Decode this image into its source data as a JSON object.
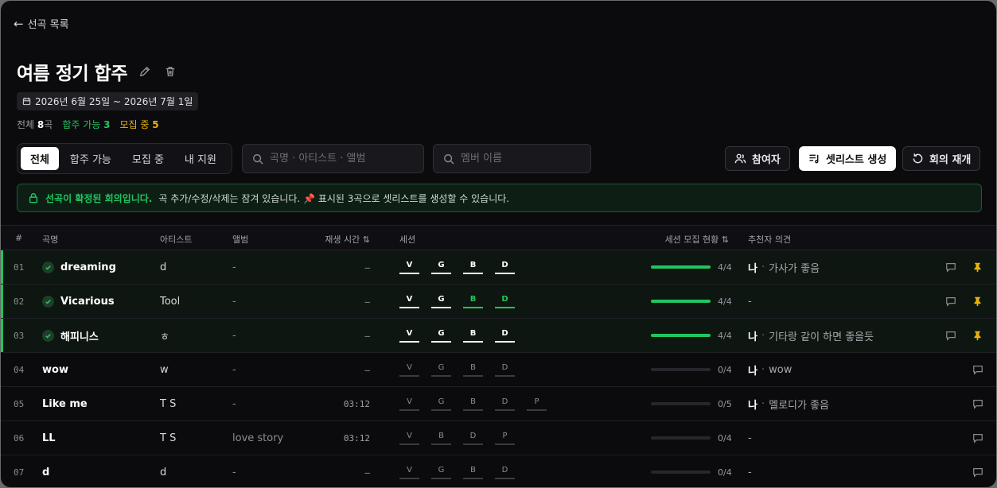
{
  "nav": {
    "back_label": "선곡 목록"
  },
  "header": {
    "title": "여름 정기 합주",
    "date_range": "2026년 6월 25일 ~ 2026년 7월 1일",
    "counts": {
      "all_label": "전체",
      "all_value": "8",
      "all_unit": "곡",
      "available_label": "합주 가능",
      "available_value": "3",
      "recruiting_label": "모집 중",
      "recruiting_value": "5"
    }
  },
  "toolbar": {
    "tabs": [
      "전체",
      "합주 가능",
      "모집 중",
      "내 지원"
    ],
    "active_tab": 0,
    "song_search_placeholder": "곡명 · 아티스트 · 앨범",
    "member_search_placeholder": "멤버 이름",
    "participants_label": "참여자",
    "setlist_label": "셋리스트 생성",
    "resume_label": "회의 재개"
  },
  "notice": {
    "strong": "선곡이 확정된 회의입니다.",
    "text": "곡 추가/수정/삭제는 잠겨 있습니다. 📌 표시된 3곡으로 셋리스트를 생성할 수 있습니다."
  },
  "table": {
    "columns": {
      "num": "#",
      "title": "곡명",
      "artist": "아티스트",
      "album": "앨범",
      "duration": "재생 시간 ⇅",
      "session": "세션",
      "progress": "세션 모집 현황 ⇅",
      "opinion": "추천자 의견"
    },
    "rows": [
      {
        "num": "01",
        "title": "dreaming",
        "artist": "d",
        "album": "-",
        "duration": "–",
        "confirmed": true,
        "sessions": [
          {
            "k": "V",
            "s": "filled"
          },
          {
            "k": "G",
            "s": "filled"
          },
          {
            "k": "B",
            "s": "filled"
          },
          {
            "k": "D",
            "s": "filled"
          }
        ],
        "progress": "4/4",
        "fill": 1.0,
        "who": "나",
        "opinion": "가사가 좋음",
        "pinned": true
      },
      {
        "num": "02",
        "title": "Vicarious",
        "artist": "Tool",
        "album": "-",
        "duration": "–",
        "confirmed": true,
        "sessions": [
          {
            "k": "V",
            "s": "filled"
          },
          {
            "k": "G",
            "s": "filled"
          },
          {
            "k": "B",
            "s": "done"
          },
          {
            "k": "D",
            "s": "done"
          }
        ],
        "progress": "4/4",
        "fill": 1.0,
        "who": "",
        "opinion": "-",
        "pinned": true
      },
      {
        "num": "03",
        "title": "해피니스",
        "artist": "ㅎ",
        "album": "-",
        "duration": "–",
        "confirmed": true,
        "sessions": [
          {
            "k": "V",
            "s": "filled"
          },
          {
            "k": "G",
            "s": "filled"
          },
          {
            "k": "B",
            "s": "filled"
          },
          {
            "k": "D",
            "s": "filled"
          }
        ],
        "progress": "4/4",
        "fill": 1.0,
        "who": "나",
        "opinion": "기타랑 같이 하면 좋을듯",
        "pinned": true
      },
      {
        "num": "04",
        "title": "wow",
        "artist": "w",
        "album": "-",
        "duration": "–",
        "confirmed": false,
        "sessions": [
          {
            "k": "V",
            "s": "empty"
          },
          {
            "k": "G",
            "s": "empty"
          },
          {
            "k": "B",
            "s": "empty"
          },
          {
            "k": "D",
            "s": "empty"
          }
        ],
        "progress": "0/4",
        "fill": 0.0,
        "who": "나",
        "opinion": "wow",
        "pinned": false
      },
      {
        "num": "05",
        "title": "Like me",
        "artist": "T S",
        "album": "-",
        "duration": "03:12",
        "confirmed": false,
        "sessions": [
          {
            "k": "V",
            "s": "empty"
          },
          {
            "k": "G",
            "s": "empty"
          },
          {
            "k": "B",
            "s": "empty"
          },
          {
            "k": "D",
            "s": "empty"
          },
          {
            "k": "P",
            "s": "empty"
          }
        ],
        "progress": "0/5",
        "fill": 0.0,
        "who": "나",
        "opinion": "멜로디가 좋음",
        "pinned": false
      },
      {
        "num": "06",
        "title": "LL",
        "artist": "T S",
        "album": "love story",
        "duration": "03:12",
        "confirmed": false,
        "sessions": [
          {
            "k": "V",
            "s": "empty"
          },
          {
            "k": "B",
            "s": "empty"
          },
          {
            "k": "D",
            "s": "empty"
          },
          {
            "k": "P",
            "s": "empty"
          }
        ],
        "progress": "0/4",
        "fill": 0.0,
        "who": "",
        "opinion": "-",
        "pinned": false
      },
      {
        "num": "07",
        "title": "d",
        "artist": "d",
        "album": "-",
        "duration": "–",
        "confirmed": false,
        "sessions": [
          {
            "k": "V",
            "s": "empty"
          },
          {
            "k": "G",
            "s": "empty"
          },
          {
            "k": "B",
            "s": "empty"
          },
          {
            "k": "D",
            "s": "empty"
          }
        ],
        "progress": "0/4",
        "fill": 0.0,
        "who": "",
        "opinion": "-",
        "pinned": false
      }
    ]
  },
  "colors": {
    "accent_green": "#22c55e",
    "accent_yellow": "#eab308",
    "pin": "#eab308",
    "background": "#0b0b0e"
  }
}
